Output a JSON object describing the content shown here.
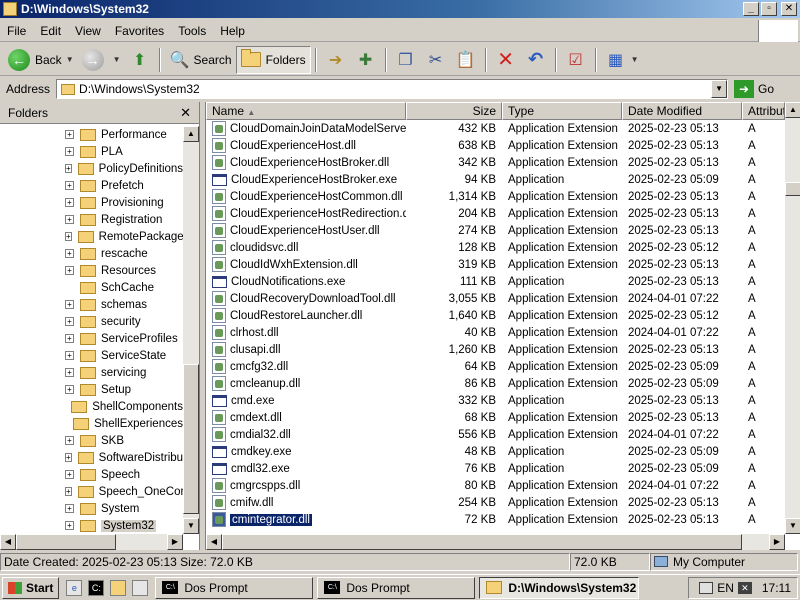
{
  "window": {
    "title": "D:\\Windows\\System32",
    "buttons": {
      "minimize": "_",
      "maximize": "▫",
      "close": "✕"
    }
  },
  "menu": [
    "File",
    "Edit",
    "View",
    "Favorites",
    "Tools",
    "Help"
  ],
  "toolbar": {
    "back_label": "Back",
    "search_label": "Search",
    "folders_label": "Folders"
  },
  "address": {
    "label": "Address",
    "value": "D:\\Windows\\System32",
    "go_label": "Go"
  },
  "folders_pane": {
    "title": "Folders",
    "items": [
      {
        "label": "Performance",
        "expandable": true
      },
      {
        "label": "PLA",
        "expandable": true
      },
      {
        "label": "PolicyDefinitions",
        "expandable": true
      },
      {
        "label": "Prefetch",
        "expandable": true
      },
      {
        "label": "Provisioning",
        "expandable": true
      },
      {
        "label": "Registration",
        "expandable": true
      },
      {
        "label": "RemotePackages",
        "expandable": true
      },
      {
        "label": "rescache",
        "expandable": true
      },
      {
        "label": "Resources",
        "expandable": true
      },
      {
        "label": "SchCache",
        "expandable": false
      },
      {
        "label": "schemas",
        "expandable": true
      },
      {
        "label": "security",
        "expandable": true
      },
      {
        "label": "ServiceProfiles",
        "expandable": true
      },
      {
        "label": "ServiceState",
        "expandable": true
      },
      {
        "label": "servicing",
        "expandable": true
      },
      {
        "label": "Setup",
        "expandable": true
      },
      {
        "label": "ShellComponents",
        "expandable": false
      },
      {
        "label": "ShellExperiences",
        "expandable": false
      },
      {
        "label": "SKB",
        "expandable": true
      },
      {
        "label": "SoftwareDistribution",
        "expandable": true
      },
      {
        "label": "Speech",
        "expandable": true
      },
      {
        "label": "Speech_OneCore",
        "expandable": true
      },
      {
        "label": "System",
        "expandable": true
      },
      {
        "label": "System32",
        "expandable": true,
        "selected": true
      }
    ]
  },
  "columns": [
    "Name",
    "Size",
    "Type",
    "Date Modified",
    "Attributes"
  ],
  "files": [
    {
      "name": "CloudDomainJoinDataModelServer...",
      "size": "432 KB",
      "type": "Application Extension",
      "date": "2025-02-23 05:13",
      "attr": "A",
      "icon": "dll"
    },
    {
      "name": "CloudExperienceHost.dll",
      "size": "638 KB",
      "type": "Application Extension",
      "date": "2025-02-23 05:13",
      "attr": "A",
      "icon": "dll"
    },
    {
      "name": "CloudExperienceHostBroker.dll",
      "size": "342 KB",
      "type": "Application Extension",
      "date": "2025-02-23 05:13",
      "attr": "A",
      "icon": "dll"
    },
    {
      "name": "CloudExperienceHostBroker.exe",
      "size": "94 KB",
      "type": "Application",
      "date": "2025-02-23 05:09",
      "attr": "A",
      "icon": "exe"
    },
    {
      "name": "CloudExperienceHostCommon.dll",
      "size": "1,314 KB",
      "type": "Application Extension",
      "date": "2025-02-23 05:13",
      "attr": "A",
      "icon": "dll"
    },
    {
      "name": "CloudExperienceHostRedirection.dll",
      "size": "204 KB",
      "type": "Application Extension",
      "date": "2025-02-23 05:13",
      "attr": "A",
      "icon": "dll"
    },
    {
      "name": "CloudExperienceHostUser.dll",
      "size": "274 KB",
      "type": "Application Extension",
      "date": "2025-02-23 05:13",
      "attr": "A",
      "icon": "dll"
    },
    {
      "name": "cloudidsvc.dll",
      "size": "128 KB",
      "type": "Application Extension",
      "date": "2025-02-23 05:12",
      "attr": "A",
      "icon": "dll"
    },
    {
      "name": "CloudIdWxhExtension.dll",
      "size": "319 KB",
      "type": "Application Extension",
      "date": "2025-02-23 05:13",
      "attr": "A",
      "icon": "dll"
    },
    {
      "name": "CloudNotifications.exe",
      "size": "111 KB",
      "type": "Application",
      "date": "2025-02-23 05:13",
      "attr": "A",
      "icon": "exe"
    },
    {
      "name": "CloudRecoveryDownloadTool.dll",
      "size": "3,055 KB",
      "type": "Application Extension",
      "date": "2024-04-01 07:22",
      "attr": "A",
      "icon": "dll"
    },
    {
      "name": "CloudRestoreLauncher.dll",
      "size": "1,640 KB",
      "type": "Application Extension",
      "date": "2025-02-23 05:12",
      "attr": "A",
      "icon": "dll"
    },
    {
      "name": "clrhost.dll",
      "size": "40 KB",
      "type": "Application Extension",
      "date": "2024-04-01 07:22",
      "attr": "A",
      "icon": "dll"
    },
    {
      "name": "clusapi.dll",
      "size": "1,260 KB",
      "type": "Application Extension",
      "date": "2025-02-23 05:13",
      "attr": "A",
      "icon": "dll"
    },
    {
      "name": "cmcfg32.dll",
      "size": "64 KB",
      "type": "Application Extension",
      "date": "2025-02-23 05:09",
      "attr": "A",
      "icon": "dll"
    },
    {
      "name": "cmcleanup.dll",
      "size": "86 KB",
      "type": "Application Extension",
      "date": "2025-02-23 05:09",
      "attr": "A",
      "icon": "dll"
    },
    {
      "name": "cmd.exe",
      "size": "332 KB",
      "type": "Application",
      "date": "2025-02-23 05:13",
      "attr": "A",
      "icon": "exe"
    },
    {
      "name": "cmdext.dll",
      "size": "68 KB",
      "type": "Application Extension",
      "date": "2025-02-23 05:13",
      "attr": "A",
      "icon": "dll"
    },
    {
      "name": "cmdial32.dll",
      "size": "556 KB",
      "type": "Application Extension",
      "date": "2024-04-01 07:22",
      "attr": "A",
      "icon": "dll"
    },
    {
      "name": "cmdkey.exe",
      "size": "48 KB",
      "type": "Application",
      "date": "2025-02-23 05:09",
      "attr": "A",
      "icon": "exe"
    },
    {
      "name": "cmdl32.exe",
      "size": "76 KB",
      "type": "Application",
      "date": "2025-02-23 05:09",
      "attr": "A",
      "icon": "exe"
    },
    {
      "name": "cmgrcspps.dll",
      "size": "80 KB",
      "type": "Application Extension",
      "date": "2024-04-01 07:22",
      "attr": "A",
      "icon": "dll"
    },
    {
      "name": "cmifw.dll",
      "size": "254 KB",
      "type": "Application Extension",
      "date": "2025-02-23 05:13",
      "attr": "A",
      "icon": "dll"
    },
    {
      "name": "cmintegrator.dll",
      "size": "72 KB",
      "type": "Application Extension",
      "date": "2025-02-23 05:13",
      "attr": "A",
      "icon": "dll",
      "selected": true
    }
  ],
  "status": {
    "info": "Date Created: 2025-02-23 05:13 Size: 72.0 KB",
    "size": "72.0 KB",
    "zone": "My Computer"
  },
  "taskbar": {
    "start": "Start",
    "tasks": [
      {
        "label": "Dos Prompt",
        "icon": "cmd",
        "active": false
      },
      {
        "label": "Dos Prompt",
        "icon": "cmd",
        "active": false
      },
      {
        "label": "D:\\Windows\\System32",
        "icon": "fold",
        "active": true
      }
    ],
    "lang": "EN",
    "time": "17:11"
  }
}
